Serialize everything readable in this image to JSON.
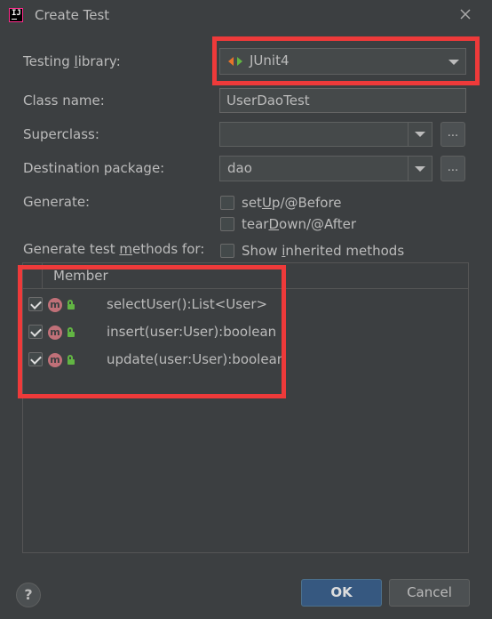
{
  "window": {
    "title": "Create Test",
    "app_icon_text": "IJ"
  },
  "form": {
    "testing_library": {
      "label_pre": "Testing ",
      "label_mn": "l",
      "label_post": "ibrary:",
      "value": "JUnit4"
    },
    "class_name": {
      "label": "Class name:",
      "value": "UserDaoTest"
    },
    "superclass": {
      "label": "Superclass:",
      "value": "",
      "browse_label": "..."
    },
    "destination_package": {
      "label": "Destination package:",
      "value": "dao",
      "browse_label": "..."
    },
    "generate": {
      "label": "Generate:",
      "setup": {
        "pre": "set",
        "mn": "U",
        "post": "p/@Before",
        "checked": false
      },
      "teardown": {
        "pre": "tear",
        "mn": "D",
        "post": "own/@After",
        "checked": false
      }
    },
    "methods_for": {
      "label_pre": "Generate test ",
      "label_mn": "m",
      "label_post": "ethods for:",
      "show_inherited": {
        "pre": "Show ",
        "mn": "i",
        "post": "nherited methods",
        "checked": false
      }
    }
  },
  "members_table": {
    "header": "Member",
    "rows": [
      {
        "name": "selectUser():List<User>",
        "checked": true,
        "icon": "m"
      },
      {
        "name": "insert(user:User):boolean",
        "checked": true,
        "icon": "m"
      },
      {
        "name": "update(user:User):boolean",
        "checked": true,
        "icon": "m"
      }
    ]
  },
  "buttons": {
    "help": "?",
    "ok": "OK",
    "cancel": "Cancel"
  },
  "colors": {
    "background": "#3c3f41",
    "highlight": "#ee3a3a",
    "ok_button": "#365880",
    "method_icon": "#c07078",
    "access_icon": "#62b543"
  }
}
